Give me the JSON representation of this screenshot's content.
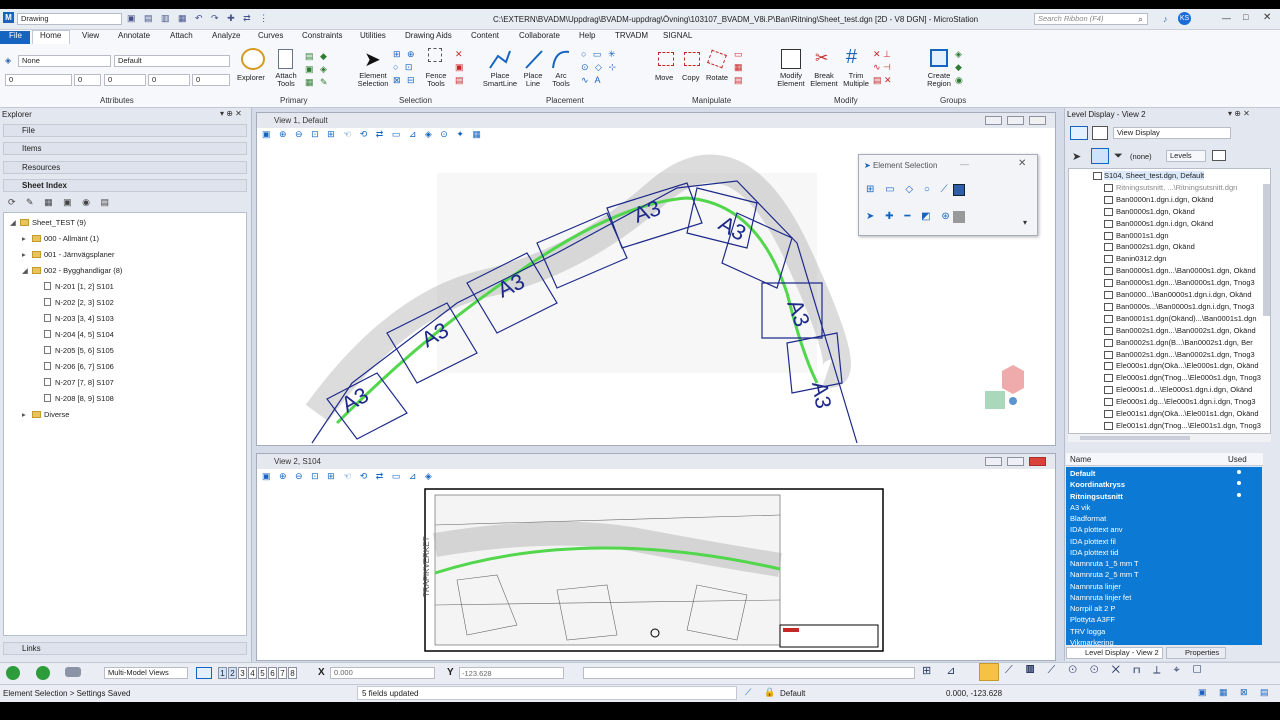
{
  "app": {
    "workflow": "Drawing",
    "title": "C:\\EXTERN\\BVADM\\Uppdrag\\BVADM-uppdrag\\Övning\\103107_BVADM_V8i.P\\Ban\\Ritning\\Sheet_test.dgn [2D - V8 DGN] - MicroStation",
    "search_placeholder": "Search Ribbon (F4)",
    "user_initials": "KS"
  },
  "tabs": [
    "File",
    "Home",
    "View",
    "Annotate",
    "Attach",
    "Analyze",
    "Curves",
    "Constraints",
    "Utilities",
    "Drawing Aids",
    "Content",
    "Collaborate",
    "Help",
    "TRVADM",
    "SIGNAL"
  ],
  "ribbon": {
    "attributes": {
      "level": "None",
      "style": "Default",
      "weight": "0",
      "color": "0",
      "transparency": "0",
      "priority": "0",
      "class": "0",
      "group_label": "Attributes"
    },
    "primary": {
      "explorer": "Explorer",
      "attach_tools": "Attach Tools",
      "group_label": "Primary"
    },
    "selection": {
      "element_selection": "Element Selection",
      "fence_tools": "Fence Tools",
      "group_label": "Selection"
    },
    "placement": {
      "place_smartline": "Place SmartLine",
      "place_line": "Place Line",
      "arc_tools": "Arc Tools",
      "group_label": "Placement"
    },
    "manipulate": {
      "move": "Move",
      "copy": "Copy",
      "rotate": "Rotate",
      "group_label": "Manipulate"
    },
    "modify": {
      "modify_element": "Modify Element",
      "break_element": "Break Element",
      "trim_multiple": "Trim Multiple",
      "group_label": "Modify"
    },
    "groups": {
      "create_region": "Create Region",
      "group_label": "Groups"
    }
  },
  "explorer": {
    "title": "Explorer",
    "sections": [
      "File",
      "Items",
      "Resources",
      "Sheet Index",
      "Links"
    ],
    "tree": [
      {
        "label": "Sheet_TEST (9)",
        "level": 0
      },
      {
        "label": "000 - Allmänt (1)",
        "level": 1
      },
      {
        "label": "001 - Järnvägsplaner",
        "level": 1
      },
      {
        "label": "002 - Bygghandligar (8)",
        "level": 1
      },
      {
        "label": "N-201 [1, 2] S101",
        "level": 2
      },
      {
        "label": "N-202 [2, 3] S102",
        "level": 2
      },
      {
        "label": "N-203 [3, 4] S103",
        "level": 2
      },
      {
        "label": "N-204 [4, 5] S104",
        "level": 2
      },
      {
        "label": "N-205 [5, 6] S105",
        "level": 2
      },
      {
        "label": "N-206 [6, 7] S106",
        "level": 2
      },
      {
        "label": "N-207 [7, 8] S107",
        "level": 2
      },
      {
        "label": "N-208 [8, 9] S108",
        "level": 2
      },
      {
        "label": "Diverse",
        "level": 1
      }
    ]
  },
  "view1": {
    "title": "View 1, Default"
  },
  "view2": {
    "title": "View 2, S104"
  },
  "element_selection": {
    "title": "Element Selection"
  },
  "level_display": {
    "title": "Level Display - View 2",
    "mode": "View Display",
    "filter": "(none)",
    "levels_dropdown": "Levels",
    "tree": [
      "S104, Sheet_test.dgn, Default",
      "Ritningsutsnitt, ...\\Ritningsutsnitt.dgn",
      "Ban0000n1.dgn.i.dgn, Okänd",
      "Ban0000s1.dgn, Okänd",
      "Ban0000s1.dgn.i.dgn, Okänd",
      "Ban0001s1.dgn",
      "Ban0002s1.dgn, Okänd",
      "Banin0312.dgn",
      "Ban0000s1.dgn...\\Ban0000s1.dgn, Okänd",
      "Ban0000s1.dgn...\\Ban0000s1.dgn, Tnog3",
      "Ban0000...\\Ban0000s1.dgn.i.dgn, Okänd",
      "Ban0000s...\\Ban0000s1.dgn.i.dgn, Tnog3",
      "Ban0001s1.dgn(Okänd)...\\Ban0001s1.dgn",
      "Ban0002s1.dgn...\\Ban0002s1.dgn, Okänd",
      "Ban0002s1.dgn(B...\\Ban0002s1.dgn, Ber",
      "Ban0002s1.dgn...\\Ban0002s1.dgn, Tnog3",
      "Ele000s1.dgn(Okä...\\Ele000s1.dgn, Okänd",
      "Ele000s1.dgn(Tnog...\\Ele000s1.dgn, Tnog3",
      "Ele000s1.d...\\Ele000s1.dgn.i.dgn, Okänd",
      "Ele000s1.dg...\\Ele000s1.dgn.i.dgn, Tnog3",
      "Ele001s1.dgn(Okä...\\Ele001s1.dgn, Okänd",
      "Ele001s1.dgn(Tnog...\\Ele001s1.dgn, Tnog3"
    ],
    "col_name": "Name",
    "col_used": "Used",
    "levels": [
      {
        "name": "Default",
        "bold": true,
        "used": true
      },
      {
        "name": "Koordinatkryss",
        "bold": true,
        "used": true
      },
      {
        "name": "Ritningsutsnitt",
        "bold": true,
        "used": true
      },
      {
        "name": "A3 vik",
        "bold": false,
        "used": false
      },
      {
        "name": "Bladformat",
        "bold": false,
        "used": false
      },
      {
        "name": "IDA plottext anv",
        "bold": false,
        "used": false
      },
      {
        "name": "IDA plottext fil",
        "bold": false,
        "used": false
      },
      {
        "name": "IDA plottext tid",
        "bold": false,
        "used": false
      },
      {
        "name": "Namnruta 1_5 mm T",
        "bold": false,
        "used": false
      },
      {
        "name": "Namnruta 2_5 mm T",
        "bold": false,
        "used": false
      },
      {
        "name": "Namnruta linjer",
        "bold": false,
        "used": false
      },
      {
        "name": "Namnruta linjer fet",
        "bold": false,
        "used": false
      },
      {
        "name": "Norrpil alt 2 P",
        "bold": false,
        "used": false
      },
      {
        "name": "Plottyta A3FF",
        "bold": false,
        "used": false
      },
      {
        "name": "TRV logga",
        "bold": false,
        "used": false
      },
      {
        "name": "Vikmarkering",
        "bold": false,
        "used": false
      }
    ],
    "bottom_tabs": [
      "Level Display - View 2",
      "Properties"
    ]
  },
  "statusbar": {
    "model_label": "Multi-Model Views",
    "view_numbers": [
      "1",
      "2",
      "3",
      "4",
      "5",
      "6",
      "7",
      "8"
    ],
    "x_label": "X",
    "x_value": "0.000",
    "y_label": "Y",
    "y_value": "-123.628",
    "left_status": "Element Selection > Settings Saved",
    "message": "5 fields updated",
    "level": "Default",
    "coords": "0.000, -123.628"
  },
  "colors": {
    "accent": "#1565c0",
    "selection": "#0c79d4",
    "track": "#52d64c",
    "sheet_frame": "#1d2a8a"
  }
}
